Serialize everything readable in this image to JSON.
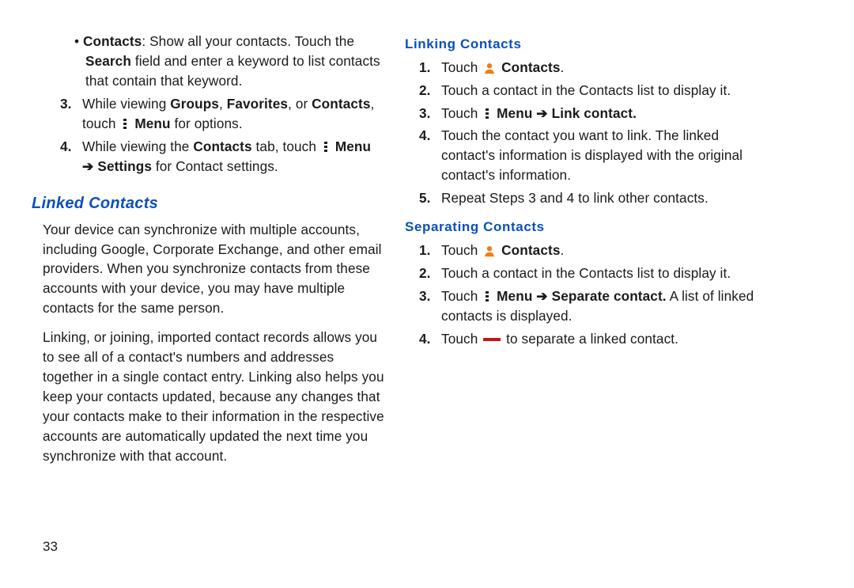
{
  "left": {
    "bullet_contacts_label": "Contacts",
    "bullet_contacts_text1": ": Show all your contacts. Touch the ",
    "bullet_contacts_bold2": "Search",
    "bullet_contacts_text2": " field and enter a keyword to list contacts that contain that keyword.",
    "item3_num": "3.",
    "item3_t1": "While viewing ",
    "item3_b1": "Groups",
    "item3_t2": ", ",
    "item3_b2": "Favorites",
    "item3_t3": ", or ",
    "item3_b3": "Contacts",
    "item3_t4": ", touch ",
    "item3_b4": "Menu",
    "item3_t5": " for options.",
    "item4_num": "4.",
    "item4_t1": "While viewing the ",
    "item4_b1": "Contacts",
    "item4_t2": " tab, touch ",
    "item4_b2": "Menu ➔ Settings",
    "item4_t3": " for Contact settings.",
    "linked_heading": "Linked Contacts",
    "p1": "Your device can synchronize with multiple accounts, including Google, Corporate Exchange, and other email providers. When you synchronize contacts from these accounts with your device, you may have multiple contacts for the same person.",
    "p2": "Linking, or joining, imported contact records allows you to see all of a contact's numbers and addresses together in a single contact entry. Linking also helps you keep your contacts updated, because any changes that your contacts make to their information in the respective accounts are automatically updated the next time you synchronize with that account."
  },
  "right": {
    "linking_heading": "Linking Contacts",
    "l1_num": "1.",
    "l1_t1": "Touch ",
    "l1_b1": "Contacts",
    "l1_t2": ".",
    "l2_num": "2.",
    "l2_t1": "Touch a contact in the Contacts list to display it.",
    "l3_num": "3.",
    "l3_t1": "Touch ",
    "l3_b1": "Menu ➔ Link contact.",
    "l4_num": "4.",
    "l4_t1": "Touch the contact you want to link. The linked contact's information is displayed with the original contact's information.",
    "l5_num": "5.",
    "l5_t1": "Repeat Steps 3 and 4 to link other contacts.",
    "separating_heading": "Separating Contacts",
    "s1_num": "1.",
    "s1_t1": "Touch ",
    "s1_b1": "Contacts",
    "s1_t2": ".",
    "s2_num": "2.",
    "s2_t1": "Touch a contact in the Contacts list to display it.",
    "s3_num": "3.",
    "s3_t1": "Touch ",
    "s3_b1": "Menu ➔ Separate contact.",
    "s3_t2": " A list of linked contacts is displayed.",
    "s4_num": "4.",
    "s4_t1": "Touch ",
    "s4_t2": " to separate a linked contact."
  },
  "page_number": "33"
}
